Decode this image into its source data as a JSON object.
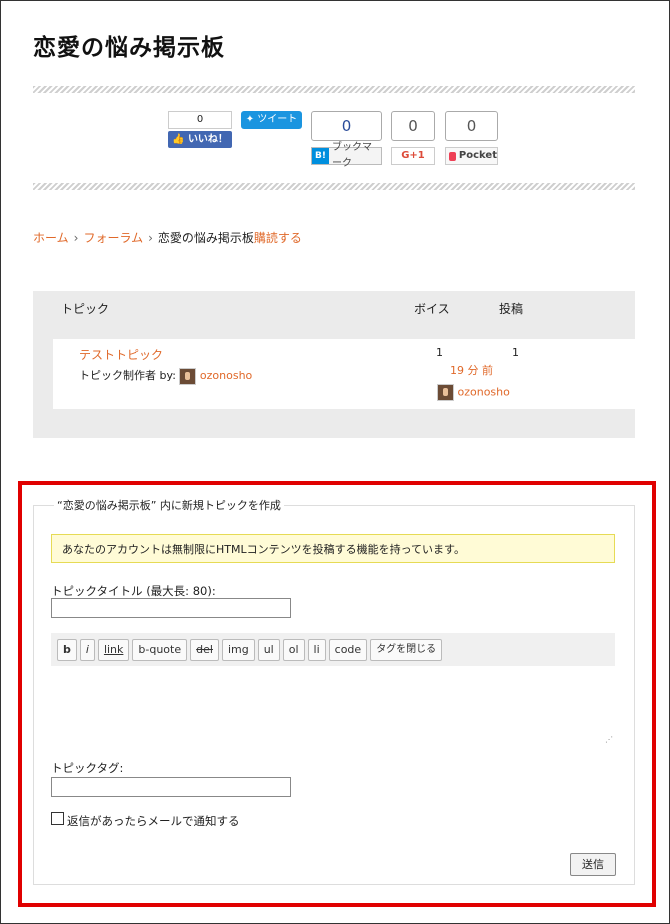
{
  "page": {
    "title": "恋愛の悩み掲示板"
  },
  "social": {
    "facebook": {
      "count": "0",
      "label": "いいね！"
    },
    "twitter": {
      "label": "ツイート"
    },
    "hatena": {
      "count": "0",
      "badge": "B!",
      "label": "ブックマーク"
    },
    "google_plus": {
      "count": "0",
      "label": "G+1"
    },
    "pocket": {
      "count": "0",
      "label": "Pocket"
    }
  },
  "breadcrumb": {
    "home": "ホーム",
    "forum": "フォーラム",
    "current": "恋愛の悩み掲示板",
    "subscribe": "購読する"
  },
  "forum_table": {
    "headers": {
      "topic": "トピック",
      "voices": "ボイス",
      "posts": "投稿"
    },
    "rows": [
      {
        "title": "テストトピック",
        "author_prefix": "トピック制作者 by:",
        "author": "ozonosho",
        "voices": "1",
        "posts": "1",
        "freshness": "19 分 前",
        "last_poster": "ozonosho"
      }
    ]
  },
  "new_topic": {
    "legend": "“恋愛の悩み掲示板” 内に新規トピックを作成",
    "notice": "あなたのアカウントは無制限にHTMLコンテンツを投稿する機能を持っています。",
    "title_label": "トピックタイトル (最大長: 80):",
    "title_value": "",
    "toolbar": [
      "b",
      "i",
      "link",
      "b-quote",
      "del",
      "img",
      "ul",
      "ol",
      "li",
      "code",
      "タグを閉じる"
    ],
    "tags_label": "トピックタグ:",
    "tags_value": "",
    "notify_label": "返信があったらメールで通知する",
    "notify_checked": false,
    "submit_label": "送信"
  }
}
